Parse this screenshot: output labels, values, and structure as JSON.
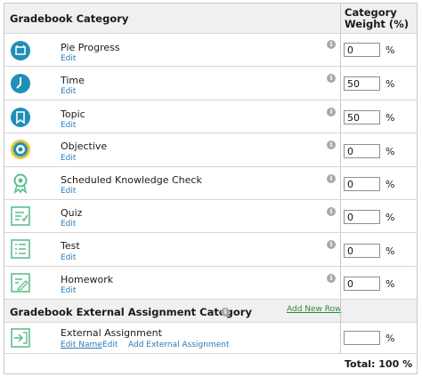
{
  "header": {
    "title": "Gradebook Category",
    "weight_line1": "Category",
    "weight_line2": "Weight (%)"
  },
  "info_glyph": "i",
  "percent_sign": "%",
  "categories": [
    {
      "name": "Pie Progress",
      "edit": "Edit",
      "weight": "0",
      "icon": "pie-progress-icon"
    },
    {
      "name": "Time",
      "edit": "Edit",
      "weight": "50",
      "icon": "clock-icon"
    },
    {
      "name": "Topic",
      "edit": "Edit",
      "weight": "50",
      "icon": "bookmark-icon"
    },
    {
      "name": "Objective",
      "edit": "Edit",
      "weight": "0",
      "icon": "target-icon"
    },
    {
      "name": "Scheduled Knowledge Check",
      "edit": "Edit",
      "weight": "0",
      "icon": "award-ribbon-icon"
    },
    {
      "name": "Quiz",
      "edit": "Edit",
      "weight": "0",
      "icon": "quiz-checklist-icon"
    },
    {
      "name": "Test",
      "edit": "Edit",
      "weight": "0",
      "icon": "test-list-icon"
    },
    {
      "name": "Homework",
      "edit": "Edit",
      "weight": "0",
      "icon": "homework-pencil-icon"
    }
  ],
  "external": {
    "title": "Gradebook External Assignment Category",
    "add_new_row": "Add New Row",
    "item": {
      "name": "External Assignment",
      "edit_name": "Edit Name",
      "edit": "Edit",
      "add_external": "Add External Assignment",
      "weight": "",
      "icon": "external-assignment-icon"
    }
  },
  "total": "Total: 100 %",
  "colors": {
    "header_bg": "#f0f0f0",
    "link_blue": "#2b7bb9",
    "add_row_green": "#2b8a3e",
    "icon_teal": "#1f8fb8",
    "icon_green": "#5cbf8a"
  }
}
